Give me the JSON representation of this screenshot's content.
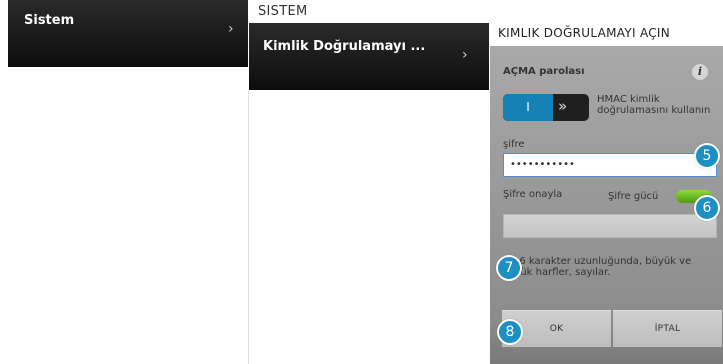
{
  "menu_level1": {
    "label": "Sistem"
  },
  "menu_level2": {
    "title": "SISTEM",
    "label": "Kimlik Doğrulamayı ..."
  },
  "dialog": {
    "title": "KIMLIK DOĞRULAMAYI AÇIN",
    "section_label": "AÇMA parolası",
    "info_icon": "i",
    "toggle": {
      "state_label": "I",
      "arrows": "»",
      "description": "HMAC kimlik doğrulamasını kullanın"
    },
    "password": {
      "label": "şifre",
      "value": "•••••••••••"
    },
    "confirm": {
      "label": "Şifre onayla",
      "value": ""
    },
    "strength_label": "Şifre gücü",
    "hint": "8-16 karakter uzunluğunda, büyük ve küçük harfler, sayılar.",
    "ok_label": "OK",
    "cancel_label": "İPTAL"
  },
  "markers": [
    "5",
    "6",
    "7",
    "8"
  ],
  "colors": {
    "accent": "#1d8fc0",
    "toggle_on": "#1580b3",
    "strength": "#6cc024"
  }
}
